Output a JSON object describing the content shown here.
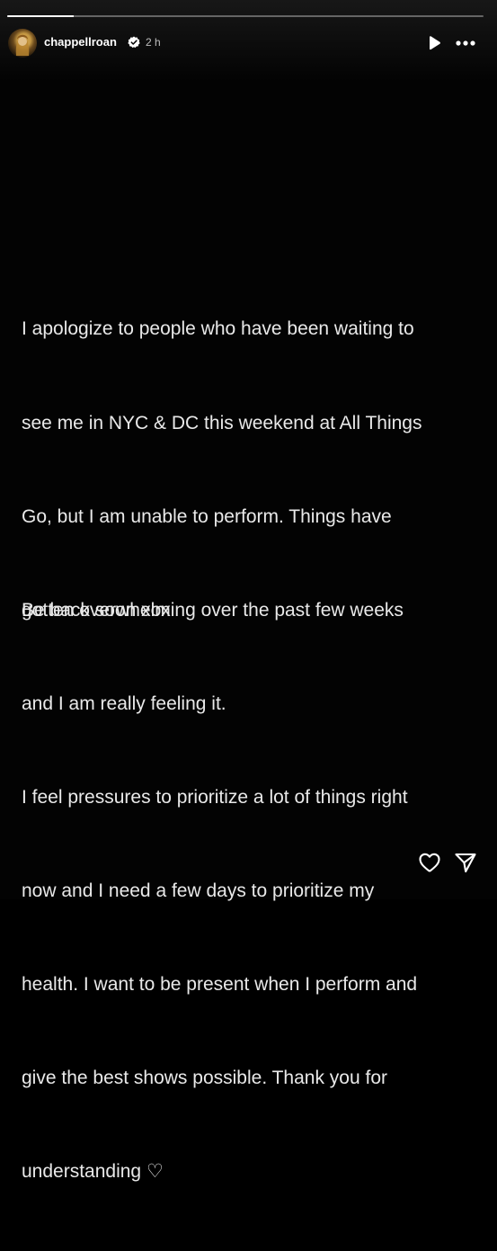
{
  "story": {
    "progress_fraction": 0.14,
    "user": {
      "username": "chappellroan",
      "timestamp": "2 h",
      "verified": true
    },
    "text_lines": [
      "I apologize to people who have been waiting to",
      "see me in NYC & DC this weekend at All Things",
      "Go, but I am unable to perform. Things have",
      "gotten overwhelming over the past few weeks",
      "and I am really feeling it.",
      "I feel pressures to prioritize a lot of things right",
      "now and I need a few days to prioritize my",
      "health. I want to be present when I perform and",
      "give the best shows possible. Thank you for",
      "understanding ♡"
    ],
    "sign_off": "Be back soon xox"
  },
  "controls": {
    "play_icon": "play-icon",
    "more_icon": "more-icon",
    "like_icon": "heart-icon",
    "share_icon": "send-icon"
  },
  "colors": {
    "background": "#030303",
    "text": "#e9e9e9",
    "verified": "#ffffff"
  }
}
